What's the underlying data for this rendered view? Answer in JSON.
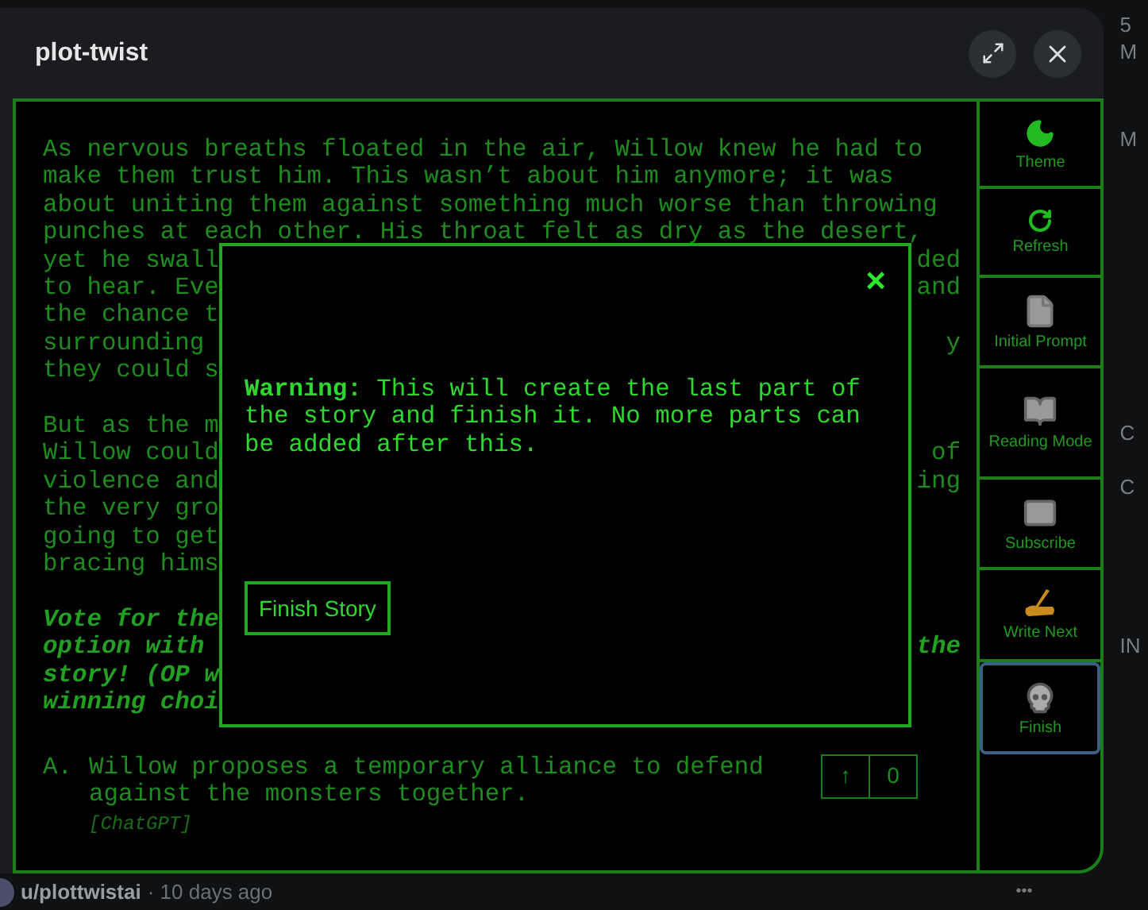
{
  "window": {
    "title": "plot-twist"
  },
  "story": {
    "paragraphs": [
      {
        "kind": "plain",
        "lines": [
          {
            "text": "As nervous breaths floated in the air, Willow knew he had to"
          },
          {
            "text": "make them trust him. This wasn’t about him anymore; it was"
          },
          {
            "text": "about uniting them against something much worse than throwing"
          },
          {
            "text": "punches at each other. His throat felt as dry as the desert,"
          },
          {
            "text": "yet he swall",
            "right": "ded"
          },
          {
            "text": "to hear. Eve",
            "right": "and"
          },
          {
            "text": "the chance t"
          },
          {
            "text": "surrounding",
            "right": "y"
          },
          {
            "text": "they could s"
          }
        ]
      },
      {
        "kind": "plain",
        "lines": [
          {
            "text": "But as the m"
          },
          {
            "text": "Willow could",
            "right": "of"
          },
          {
            "text": "violence and",
            "right": "ing"
          },
          {
            "text": "the very gro"
          },
          {
            "text": "going to get"
          },
          {
            "text": "bracing hims"
          }
        ]
      },
      {
        "kind": "emphasis",
        "lines": [
          {
            "text": "Vote for the"
          },
          {
            "text": "option with",
            "right": "the"
          },
          {
            "text": "story! (OP w"
          },
          {
            "text": "winning choi"
          }
        ]
      }
    ],
    "options": [
      {
        "letter": "A.",
        "lines": [
          "Willow proposes a temporary alliance to defend",
          "against the monsters together."
        ],
        "source": "[ChatGPT]",
        "arrow": "↑",
        "votes": "0"
      }
    ]
  },
  "sidebar": {
    "items": [
      {
        "kind": "theme",
        "label": "Theme",
        "selected": false
      },
      {
        "kind": "refresh",
        "label": "Refresh",
        "selected": false
      },
      {
        "kind": "prompt",
        "label": "Initial Prompt",
        "selected": false
      },
      {
        "kind": "reading",
        "label": "Reading Mode",
        "selected": false
      },
      {
        "kind": "subscribe",
        "label": "Subscribe",
        "selected": false
      },
      {
        "kind": "write",
        "label": "Write Next",
        "selected": false
      },
      {
        "kind": "finish",
        "label": "Finish",
        "selected": true
      }
    ]
  },
  "dialog": {
    "close": "×",
    "message": "**Warning:** This will create the last part of the story and finish it. No more parts can be added after this.",
    "button": "Finish Story"
  },
  "post_footer": {
    "author": "u/plottwistai",
    "time": "· 10 days ago",
    "more": "•••"
  },
  "page_behind": {
    "letters": [
      "5",
      "M",
      "M",
      "C",
      "C",
      "IN"
    ]
  }
}
